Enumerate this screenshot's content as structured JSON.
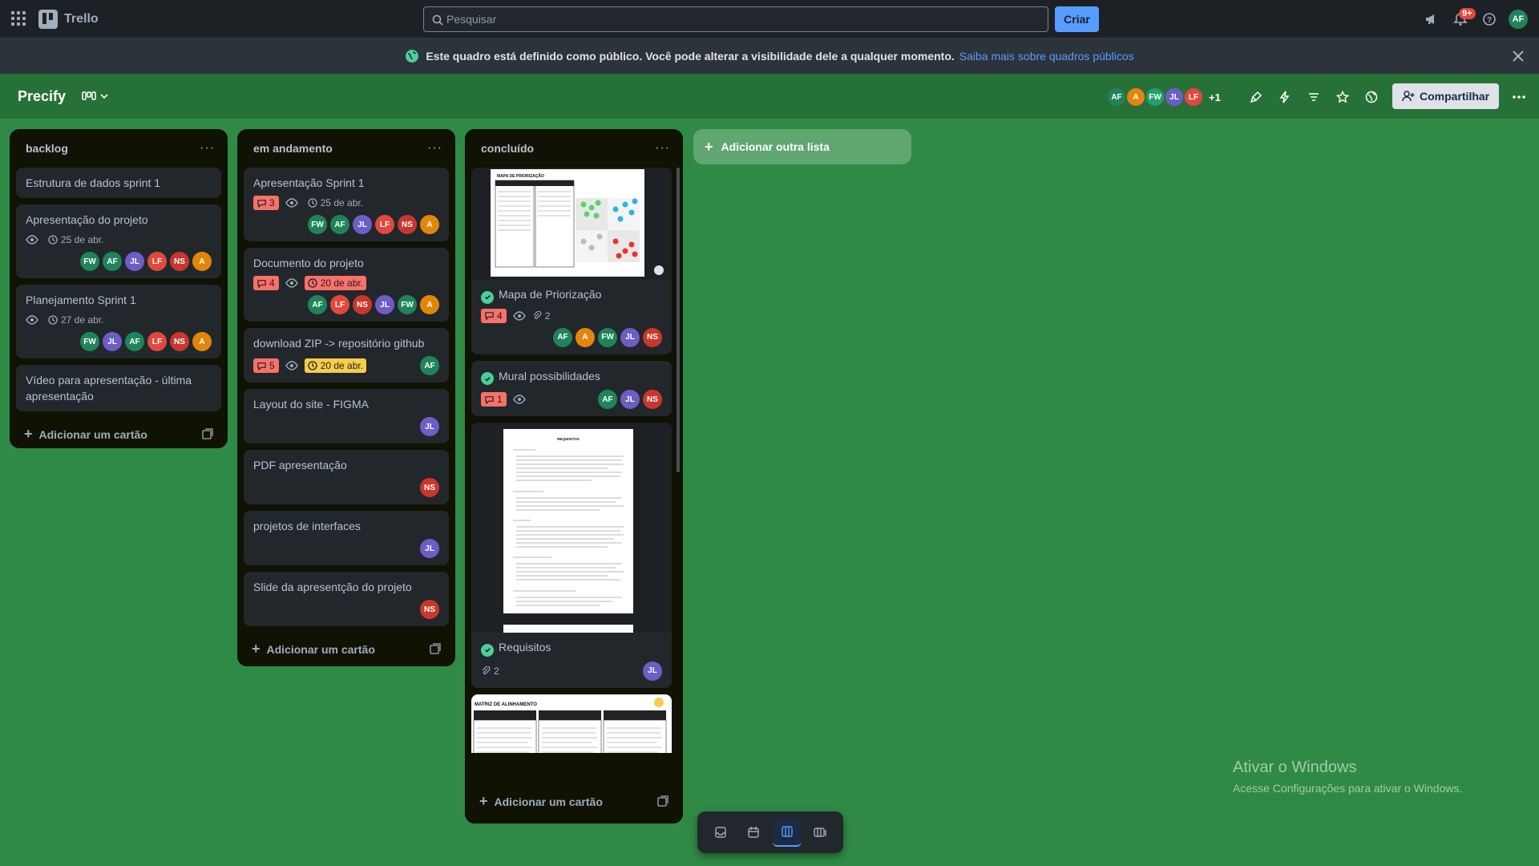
{
  "app": {
    "name": "Trello"
  },
  "search": {
    "placeholder": "Pesquisar"
  },
  "topbar": {
    "create_label": "Criar",
    "notif_count": "9+",
    "user_initials": "AF"
  },
  "banner": {
    "text": "Este quadro está definido como público. Você pode alterar a visibilidade dele a qualquer momento.",
    "link": "Saiba mais sobre quadros públicos"
  },
  "board": {
    "title": "Precify",
    "members": [
      {
        "initials": "AF",
        "color": "#1f845a"
      },
      {
        "initials": "A",
        "color": "#e2860b"
      },
      {
        "initials": "FW",
        "color": "#22a06b"
      },
      {
        "initials": "JL",
        "color": "#6e5dc6"
      },
      {
        "initials": "LF",
        "color": "#e2483d"
      }
    ],
    "more_members": "+1",
    "share_label": "Compartilhar"
  },
  "colors": {
    "FW": "#1f845a",
    "AF": "#1f845a",
    "JL": "#6e5dc6",
    "LF": "#e2483d",
    "NS": "#c9372c",
    "A": "#e2860b",
    "background": "#2f8a45",
    "list": "#101204",
    "card": "#22272b"
  },
  "lists": [
    {
      "title": "backlog",
      "cards": [
        {
          "title": "Estrutura de dados sprint 1"
        },
        {
          "title": "Apresentação do projeto",
          "date": "25 de abr.",
          "members": [
            "FW",
            "AF",
            "JL",
            "LF",
            "NS",
            "A"
          ]
        },
        {
          "title": "Planejamento Sprint 1",
          "date": "27 de abr.",
          "members": [
            "FW",
            "JL",
            "AF",
            "LF",
            "NS",
            "A"
          ]
        },
        {
          "title": "Vídeo para apresentação - última apresentação"
        }
      ],
      "add_label": "Adicionar um cartão"
    },
    {
      "title": "em andamento",
      "cards": [
        {
          "title": "Apresentação Sprint 1",
          "comments": "3",
          "date": "25 de abr.",
          "members": [
            "FW",
            "AF",
            "JL",
            "LF",
            "NS",
            "A"
          ]
        },
        {
          "title": "Documento do projeto",
          "comments": "4",
          "date": "20 de abr.",
          "members": [
            "AF",
            "LF",
            "NS",
            "JL",
            "FW",
            "A"
          ]
        },
        {
          "title": "download ZIP -> repositório github",
          "comments": "5",
          "date": "20 de abr.",
          "members": [
            "AF"
          ]
        },
        {
          "title": "Layout do site - FIGMA",
          "members": [
            "JL"
          ]
        },
        {
          "title": "PDF apresentação",
          "members": [
            "NS"
          ]
        },
        {
          "title": "projetos de interfaces",
          "members": [
            "JL"
          ]
        },
        {
          "title": "Slide da apresentção do projeto",
          "members": [
            "NS"
          ]
        }
      ],
      "add_label": "Adicionar um cartão"
    },
    {
      "title": "concluído",
      "cards": [
        {
          "title": "Mapa de Priorização",
          "comments": "4",
          "attachments": "2",
          "members": [
            "AF",
            "A",
            "FW",
            "JL",
            "NS"
          ],
          "cover_title": "MAPA DE PRIORIZAÇÃO"
        },
        {
          "title": "Mural possibilidades",
          "comments": "1",
          "members": [
            "AF",
            "JL",
            "NS"
          ]
        },
        {
          "title": "Requisitos",
          "attachments": "2",
          "members": [
            "JL"
          ],
          "cover_title": "REQUISITOS"
        },
        {
          "cover_title": "MATRIZ DE ALINHAMENTO"
        }
      ],
      "add_label": "Adicionar um cartão"
    }
  ],
  "add_list_label": "Adicionar outra lista",
  "watermark": {
    "line1": "Ativar o Windows",
    "line2": "Acesse Configurações para ativar o Windows."
  }
}
